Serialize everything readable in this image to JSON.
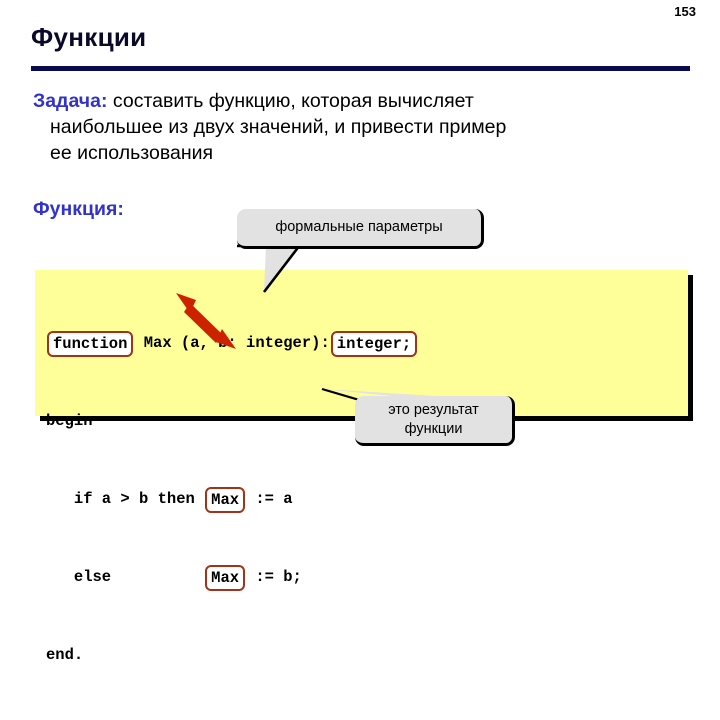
{
  "slide": {
    "page_number": "153",
    "title": "Функции",
    "accent_color": "#0a0a50",
    "lead_color": "#3333cc",
    "code_panel_color": "#ffff99",
    "callout_color": "#e2e2e2",
    "code_box_border_color": "#a03318",
    "arrow_color": "#cc2200"
  },
  "task": {
    "label": "Задача:",
    "line1": " составить функцию, которая вычисляет",
    "line2": "наибольшее из двух значений, и привести пример",
    "line3": "ее использования"
  },
  "function_label": "Функция:",
  "callouts": {
    "params": "формальные параметры",
    "result_line1": "это результат",
    "result_line2": "функции"
  },
  "code": {
    "line1": {
      "box1": "function",
      "mid": " Max (a, b: integer):",
      "box2": "integer;"
    },
    "line2": {
      "text": "begin"
    },
    "line3": {
      "prefix": "   if a > b then ",
      "box": "Max",
      "suffix": " := a"
    },
    "line4": {
      "prefix": "   else          ",
      "box": "Max",
      "suffix": " := b;"
    },
    "line5": {
      "text": "end."
    }
  }
}
